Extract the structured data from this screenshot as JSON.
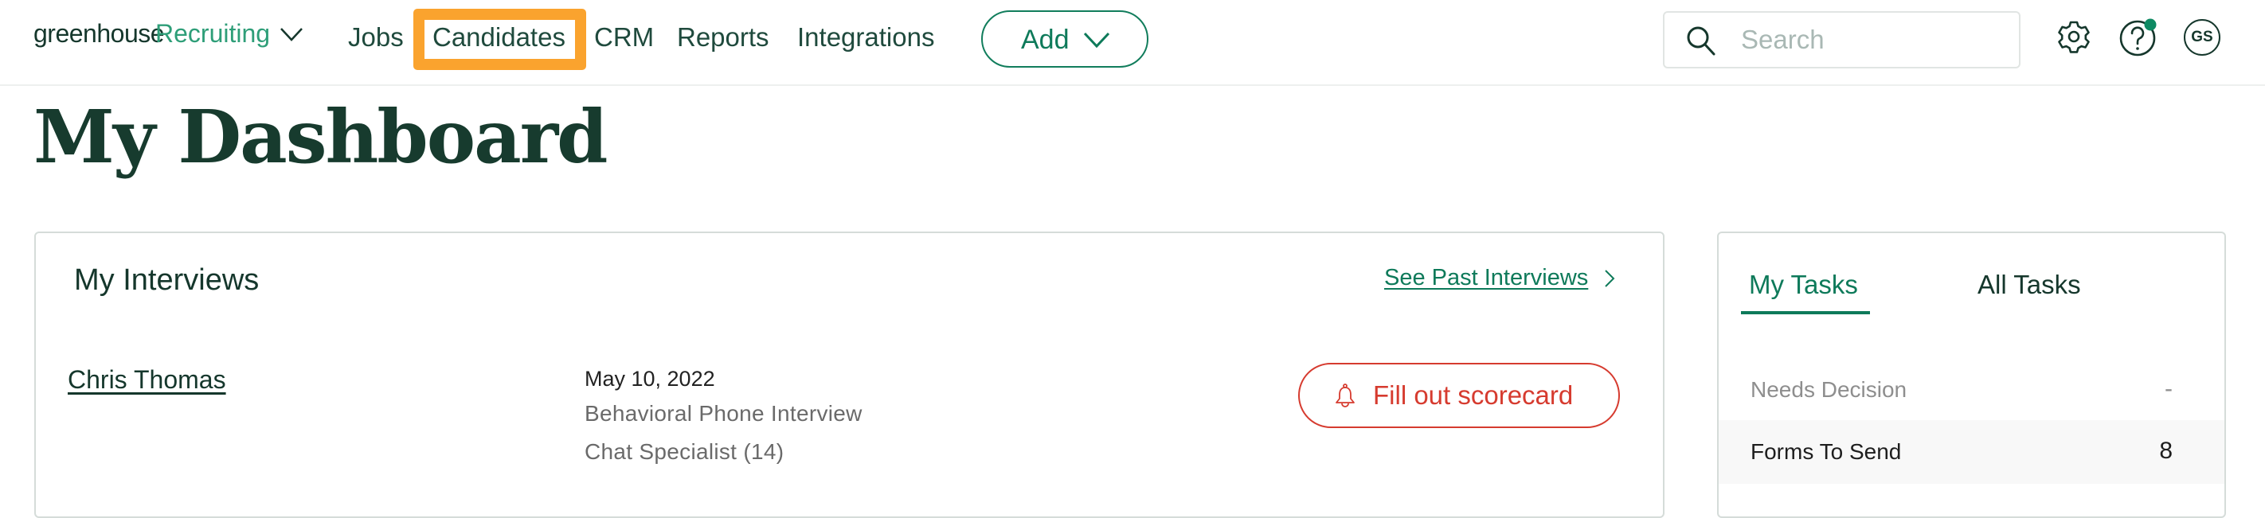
{
  "header": {
    "logo": {
      "brand": "greenhouse",
      "product": "Recruiting"
    },
    "nav": [
      {
        "label": "Jobs",
        "highlighted": false
      },
      {
        "label": "Candidates",
        "highlighted": true
      },
      {
        "label": "CRM",
        "highlighted": false
      },
      {
        "label": "Reports",
        "highlighted": false
      },
      {
        "label": "Integrations",
        "highlighted": false
      }
    ],
    "add_button": {
      "label": "Add"
    },
    "search": {
      "placeholder": "Search",
      "value": ""
    },
    "icons": [
      "gear-icon",
      "help-icon",
      "avatar"
    ],
    "avatar_initials": "GS",
    "help_notification": true,
    "highlight_color": "#FAA32E"
  },
  "page": {
    "title": "My Dashboard"
  },
  "interviews": {
    "title": "My Interviews",
    "past_link": "See Past Interviews",
    "items": [
      {
        "candidate": "Chris Thomas",
        "date": "May 10, 2022",
        "interview": "Behavioral Phone Interview",
        "job": "Chat Specialist (14)",
        "action": "Fill out scorecard"
      }
    ]
  },
  "tasks": {
    "tabs": [
      {
        "label": "My Tasks",
        "active": true
      },
      {
        "label": "All Tasks",
        "active": false
      }
    ],
    "items": [
      {
        "label": "Needs Decision",
        "value": "-",
        "muted": true
      },
      {
        "label": "Forms To Send",
        "value": "8",
        "muted": false
      }
    ]
  },
  "colors": {
    "brand_green": "#0E7A5A",
    "alert_red": "#D63B2F",
    "text_dark": "#15372C"
  }
}
